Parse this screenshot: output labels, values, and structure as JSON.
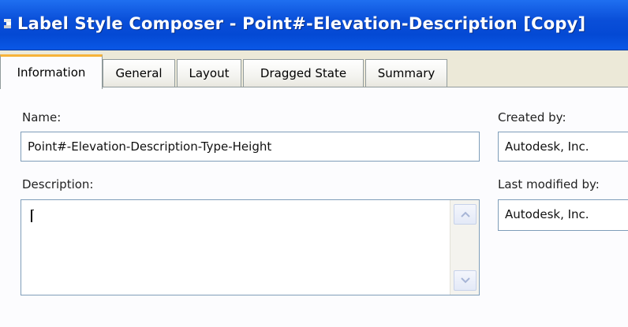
{
  "window": {
    "title": "Label Style Composer - Point#-Elevation-Description [Copy]"
  },
  "tabs": [
    {
      "label": "Information",
      "active": true
    },
    {
      "label": "General",
      "active": false
    },
    {
      "label": "Layout",
      "active": false
    },
    {
      "label": "Dragged State",
      "active": false
    },
    {
      "label": "Summary",
      "active": false
    }
  ],
  "form": {
    "name_label": "Name:",
    "name_value": "Point#-Elevation-Description-Type-Height",
    "description_label": "Description:",
    "description_value": "",
    "created_by_label": "Created by:",
    "created_by_value": "Autodesk, Inc.",
    "last_modified_by_label": "Last modified by:",
    "last_modified_by_value": "Autodesk, Inc."
  },
  "colors": {
    "titlebar": "#0449d4",
    "active_tab_accent": "#f7b339",
    "field_border": "#7f9db9"
  }
}
